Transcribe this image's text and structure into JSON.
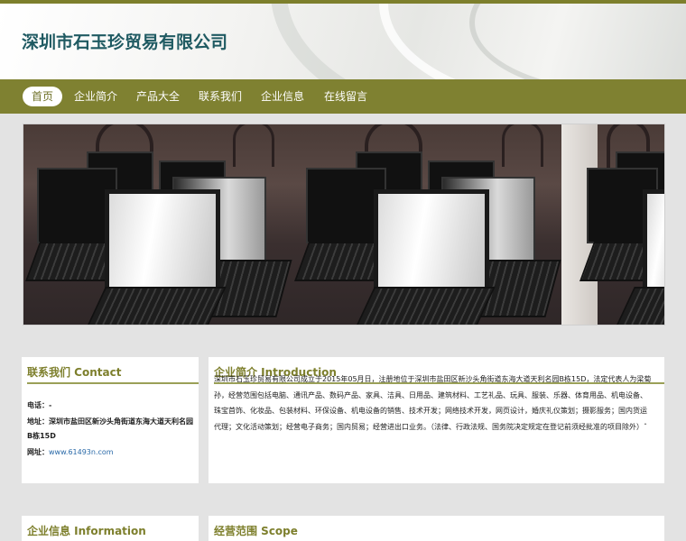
{
  "site": {
    "title": "深圳市石玉珍贸易有限公司"
  },
  "nav": {
    "items": [
      {
        "label": "首页",
        "active": true
      },
      {
        "label": "企业简介"
      },
      {
        "label": "产品大全"
      },
      {
        "label": "联系我们"
      },
      {
        "label": "企业信息"
      },
      {
        "label": "在线留言"
      }
    ]
  },
  "contact": {
    "title": "联系我们 Contact",
    "phone_label": "电话：",
    "phone_value": "-",
    "address_label": "地址：",
    "address_value": "深圳市盐田区新沙头角街道东海大道天利名园B栋15D",
    "website_label": "网址：",
    "website_value": "www.61493n.com"
  },
  "intro": {
    "title": "企业简介 Introduction",
    "text": "深圳市石玉珍贸易有限公司成立于2015年05月日，注册地位于深圳市盐田区新沙头角街道东海大道天利名园B栋15D，法定代表人为梁菊孙，经营范围包括电脑、通讯产品、数码产品、家具、洁具、日用品、建筑材料、工艺礼品、玩具、服装、乐器、体育用品、机电设备、珠宝首饰、化妆品、包装材料、环保设备、机电设备的销售、技术开发；网络技术开发，网页设计，婚庆礼仪策划；摄影服务；国内货运代理；文化活动策划；经营电子商务；国内贸易；经营进出口业务。（法律、行政法规、国务院决定规定在登记前须经批准的项目除外）ˆ"
  },
  "info": {
    "title": "企业信息 Information"
  },
  "scope": {
    "title": "经营范围 Scope"
  },
  "colors": {
    "nav": "#7f8131",
    "accent": "#7d7f2c",
    "title": "#1f5a62"
  }
}
